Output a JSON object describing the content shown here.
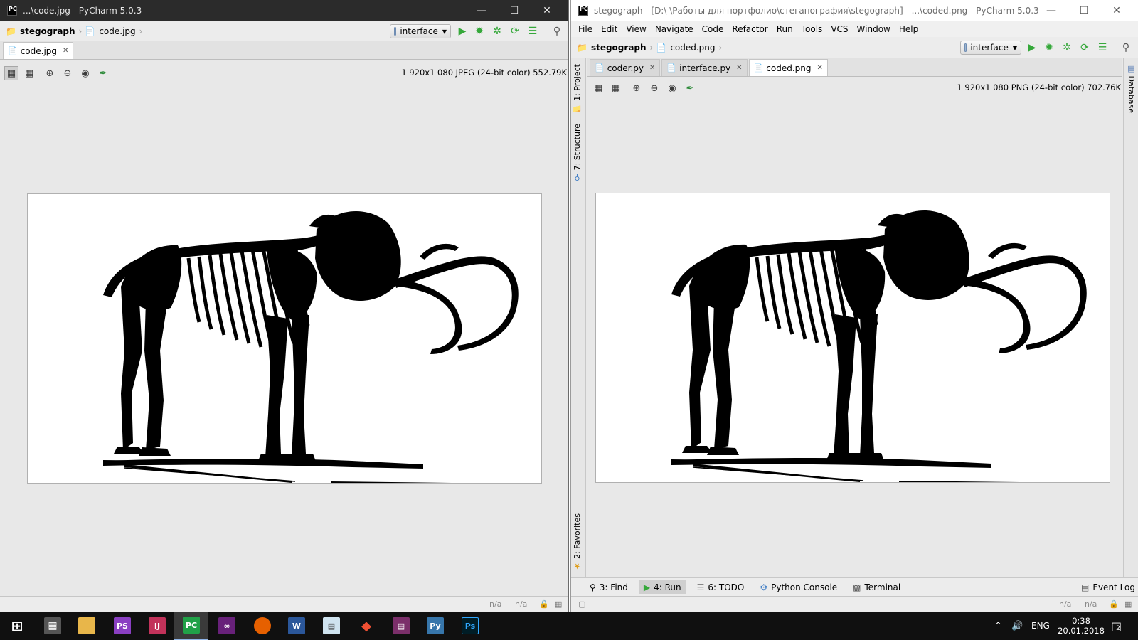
{
  "left_window": {
    "title": "...\\code.jpg - PyCharm 5.0.3",
    "breadcrumb": [
      "stegograph",
      "code.jpg"
    ],
    "run_config": "interface",
    "tabs": [
      {
        "label": "code.jpg",
        "active": true
      }
    ],
    "image_info": "1 920x1 080 JPEG (24-bit color) 552.79K",
    "status": [
      "n/a",
      "n/a"
    ]
  },
  "right_window": {
    "title": "stegograph - [D:\\ \\Работы для портфолио\\стеганография\\stegograph] - ...\\coded.png - PyCharm 5.0.3",
    "menu": [
      "File",
      "Edit",
      "View",
      "Navigate",
      "Code",
      "Refactor",
      "Run",
      "Tools",
      "VCS",
      "Window",
      "Help"
    ],
    "breadcrumb": [
      "stegograph",
      "coded.png"
    ],
    "run_config": "interface",
    "tabs": [
      {
        "label": "coder.py",
        "active": false
      },
      {
        "label": "interface.py",
        "active": false
      },
      {
        "label": "coded.png",
        "active": true
      }
    ],
    "image_info": "1 920x1 080 PNG (24-bit color) 702.76K",
    "side_tabs": {
      "project": "1: Project",
      "structure": "7: Structure",
      "favorites": "2: Favorites",
      "database": "Database"
    },
    "tool_windows": [
      "3: Find",
      "4: Run",
      "6: TODO",
      "Python Console",
      "Terminal"
    ],
    "event_log": "Event Log",
    "status": [
      "n/a",
      "n/a"
    ]
  },
  "taskbar": {
    "apps": [
      "windows-start",
      "calculator",
      "file-explorer",
      "phpstorm",
      "intellij-idea",
      "pycharm",
      "visual-studio",
      "firefox",
      "word",
      "notepad",
      "git",
      "winrar",
      "python",
      "photoshop"
    ],
    "active_app": "pycharm",
    "language": "ENG",
    "time": "0:38",
    "date": "20.01.2018",
    "notification_count": "2"
  },
  "colors": {
    "titlebar_dark": "#2b2b2b",
    "ide_bg": "#e8e8e8",
    "run_green": "#35a83a",
    "taskbar": "#101010"
  }
}
